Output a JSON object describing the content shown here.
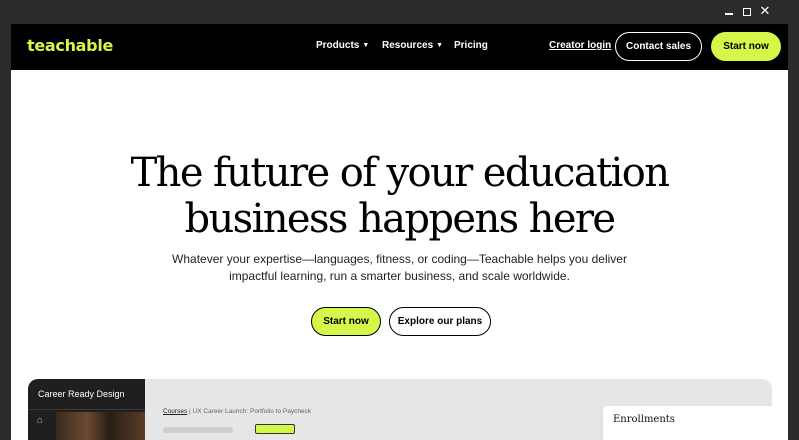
{
  "window_controls": {
    "minimize": "—",
    "maximize": "☐",
    "close": "✕"
  },
  "nav": {
    "logo": "teachable",
    "links": [
      {
        "label": "Products",
        "has_dropdown": true
      },
      {
        "label": "Resources",
        "has_dropdown": true
      },
      {
        "label": "Pricing",
        "has_dropdown": false
      }
    ],
    "creator_login": "Creator login",
    "contact_sales": "Contact sales",
    "start_now": "Start now"
  },
  "hero": {
    "title_line1": "The future of your education",
    "title_line2": "business happens here",
    "subtitle_line1": "Whatever your expertise—languages, fitness, or coding—Teachable helps you deliver",
    "subtitle_line2": "impactful learning, run a smarter business, and scale worldwide.",
    "primary_cta": "Start now",
    "secondary_cta": "Explore our plans"
  },
  "preview": {
    "sidebar_title": "Career Ready Design",
    "breadcrumb_link": "Courses",
    "breadcrumb_sep": "|",
    "breadcrumb_current": "UX Career Launch: Portfolio to Paycheck",
    "card_title": "Enrollments"
  },
  "colors": {
    "brand_accent": "#d4f74a",
    "nav_bg": "#000000"
  }
}
